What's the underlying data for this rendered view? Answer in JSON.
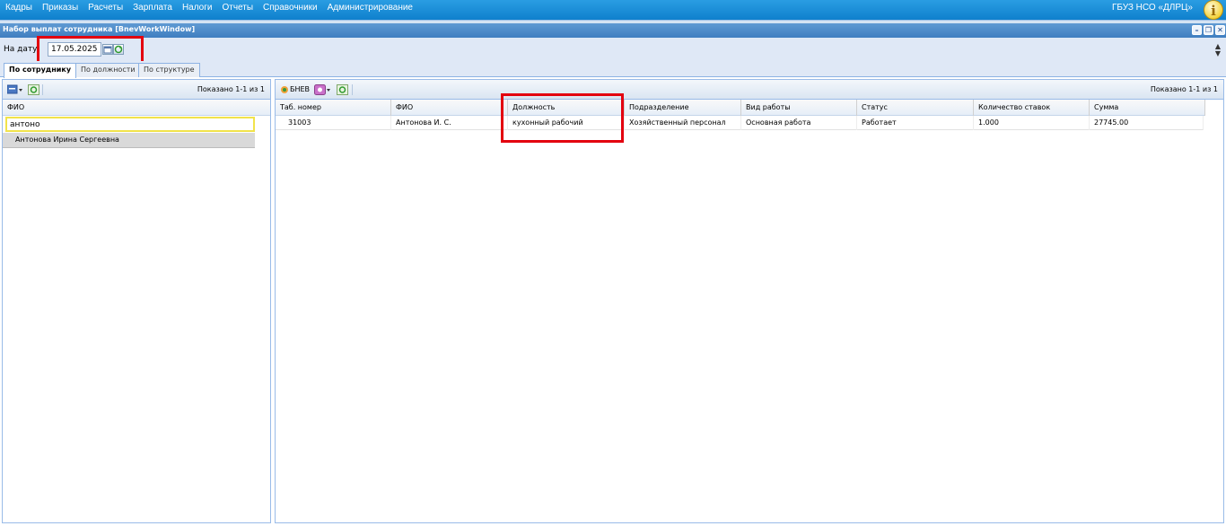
{
  "menu": {
    "items": [
      "Кадры",
      "Приказы",
      "Расчеты",
      "Зарплата",
      "Налоги",
      "Отчеты",
      "Справочники",
      "Администрирование"
    ],
    "org": "ГБУЗ НСО «ДЛРЦ»"
  },
  "window": {
    "title": "Набор выплат сотрудника [BnevWorkWindow]",
    "date_label": "На дату:",
    "date_value": "17.05.2025"
  },
  "tabs": [
    "По сотруднику",
    "По должности",
    "По структуре"
  ],
  "left": {
    "shown": "Показано 1-1 из 1",
    "column": "ФИО",
    "filter_value": "антоно",
    "rows": [
      "Антонова Ирина Сергеевна"
    ]
  },
  "right": {
    "toolbar_label": "БНЕВ",
    "shown": "Показано 1-1 из 1",
    "columns": [
      "Таб. номер",
      "ФИО",
      "Должность",
      "Подразделение",
      "Вид работы",
      "Статус",
      "Количество ставок",
      "Сумма"
    ],
    "rows": [
      [
        "31003",
        "Антонова И. С.",
        "кухонный рабочий",
        "Хозяйственный персонал",
        "Основная работа",
        "Работает",
        "1.000",
        "27745.00"
      ]
    ]
  },
  "colors": {
    "menubar": "#1a8fd8",
    "highlight": "#e3000f"
  }
}
